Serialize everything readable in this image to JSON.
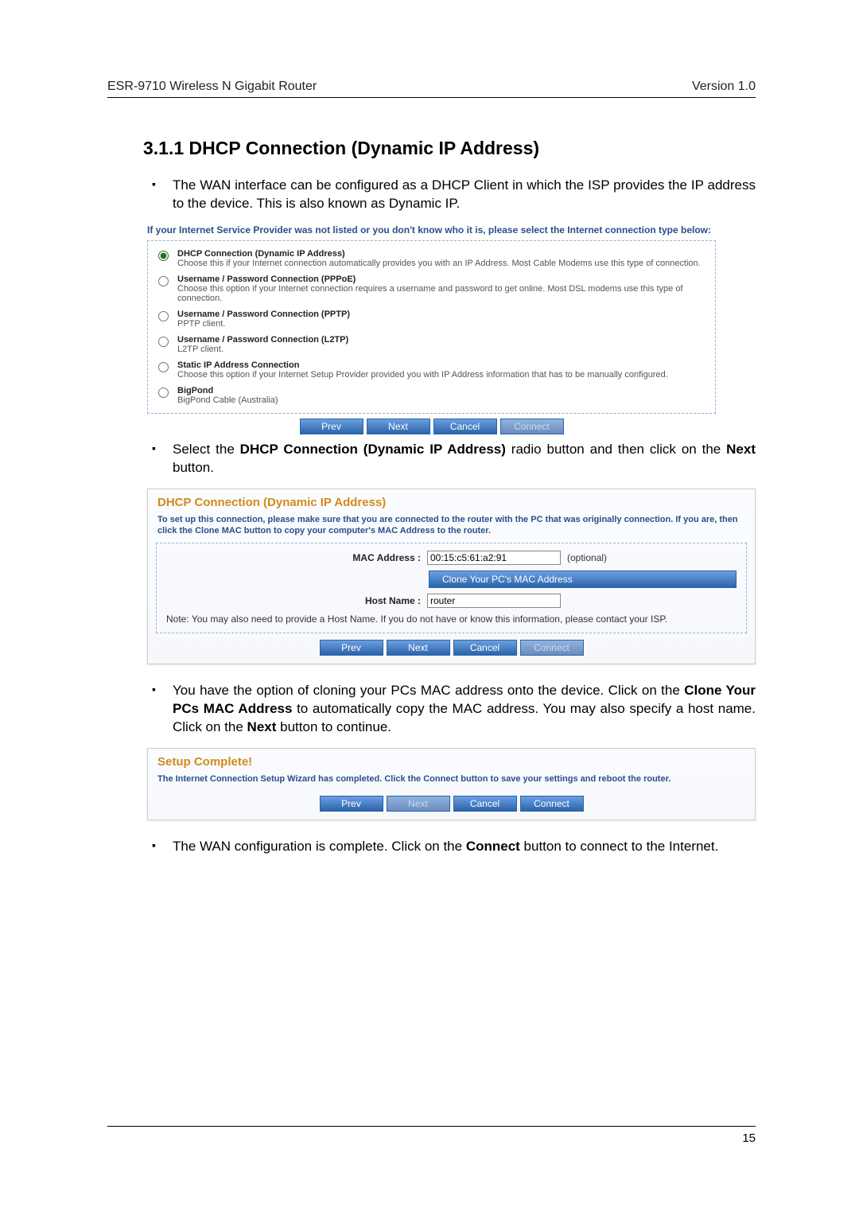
{
  "header": {
    "left": "ESR-9710 Wireless N Gigabit Router",
    "right": "Version 1.0"
  },
  "title": "3.1.1 DHCP Connection (Dynamic IP Address)",
  "para1": "The WAN interface can be configured as a DHCP Client in which the ISP provides the IP address to the device. This is also known as Dynamic IP.",
  "intro": "If your Internet Service Provider was not listed or you don't know who it is, please select the Internet connection type below:",
  "options": [
    {
      "title": "DHCP Connection (Dynamic IP Address)",
      "desc": "Choose this if your Internet connection automatically provides you with an IP Address. Most Cable Modems use this type of connection.",
      "checked": true
    },
    {
      "title": "Username / Password Connection (PPPoE)",
      "desc": "Choose this option if your Internet connection requires a username and password to get online. Most DSL modems use this type of connection.",
      "checked": false
    },
    {
      "title": "Username / Password Connection (PPTP)",
      "desc": "PPTP client.",
      "checked": false
    },
    {
      "title": "Username / Password Connection (L2TP)",
      "desc": "L2TP client.",
      "checked": false
    },
    {
      "title": "Static IP Address Connection",
      "desc": "Choose this option if your Internet Setup Provider provided you with IP Address information that has to be manually configured.",
      "checked": false
    },
    {
      "title": "BigPond",
      "desc": "BigPond Cable (Australia)",
      "checked": false
    }
  ],
  "btns": {
    "prev": "Prev",
    "next": "Next",
    "cancel": "Cancel",
    "connect": "Connect"
  },
  "para2_a": "Select the ",
  "para2_b": "DHCP Connection (Dynamic IP Address)",
  "para2_c": " radio button and then click on the ",
  "para2_d": "Next",
  "para2_e": " button.",
  "dhcp": {
    "title": "DHCP Connection (Dynamic IP Address)",
    "sub": "To set up this connection, please make sure that you are connected to the router with the PC that was originally connection. If you are, then click the Clone MAC button to copy your computer's MAC Address to the router.",
    "mac_label": "MAC Address :",
    "mac_value": "00:15:c5:61:a2:91",
    "mac_hint": "(optional)",
    "clone": "Clone Your PC's MAC Address",
    "host_label": "Host Name :",
    "host_value": "router",
    "note": "Note: You may also need to provide a Host Name. If you do not have or know this information, please contact your ISP."
  },
  "para3_a": "You have the option of cloning your PCs MAC address onto the device. Click on the ",
  "para3_b": "Clone Your PCs MAC Address",
  "para3_c": " to automatically copy the MAC address. You may also specify a host name. Click on the ",
  "para3_d": "Next",
  "para3_e": " button to continue.",
  "complete": {
    "title": "Setup Complete!",
    "sub": "The Internet Connection Setup Wizard has completed. Click the Connect button to save your settings and reboot the router."
  },
  "para4_a": "The WAN configuration is complete. Click on the ",
  "para4_b": "Connect",
  "para4_c": " button to connect to the Internet.",
  "page_number": "15"
}
